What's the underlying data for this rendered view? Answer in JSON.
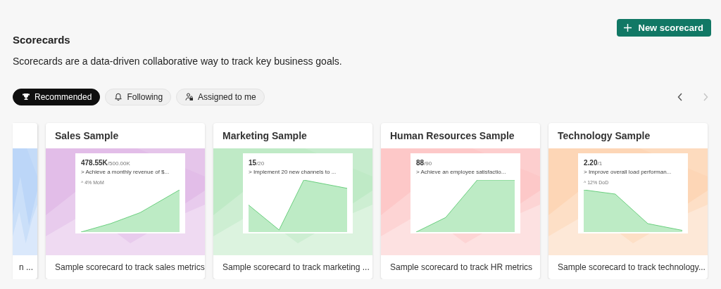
{
  "header": {
    "title": "Scorecards",
    "new_button": "New scorecard"
  },
  "description": "Scorecards are a data-driven collaborative way to track key business goals.",
  "filters": [
    {
      "label": "Recommended",
      "selected": true
    },
    {
      "label": "Following",
      "selected": false
    },
    {
      "label": "Assigned to me",
      "selected": false
    }
  ],
  "pager": {
    "previous_disabled": false,
    "next_disabled": true
  },
  "partial_card": {
    "footer": "n ...",
    "color": "#bcd6f8"
  },
  "cards": [
    {
      "title": "Sales Sample",
      "color": "#e2bde8",
      "value": "478.55K",
      "target": "/500.00K",
      "goal": "> Achieve a monthly revenue of $...",
      "change": "^ 4% MoM",
      "footer": "Sample scorecard to track sales metrics"
    },
    {
      "title": "Marketing Sample",
      "color": "#bfeac6",
      "value": "15",
      "target": "/20",
      "goal": "> Implement 20 new channels to ...",
      "footer": "Sample scorecard to track marketing ..."
    },
    {
      "title": "Human Resources Sample",
      "color": "#fdc8c8",
      "value": "88",
      "target": "/90",
      "goal": "> Achieve an employee satisfactio...",
      "footer": "Sample scorecard to track HR metrics"
    },
    {
      "title": "Technology Sample",
      "color": "#fdd6b6",
      "value": "2.20",
      "target": "/1",
      "goal": "> Improve overall load performan...",
      "change": "^ 12% DoD",
      "footer": "Sample scorecard to track technology..."
    }
  ]
}
